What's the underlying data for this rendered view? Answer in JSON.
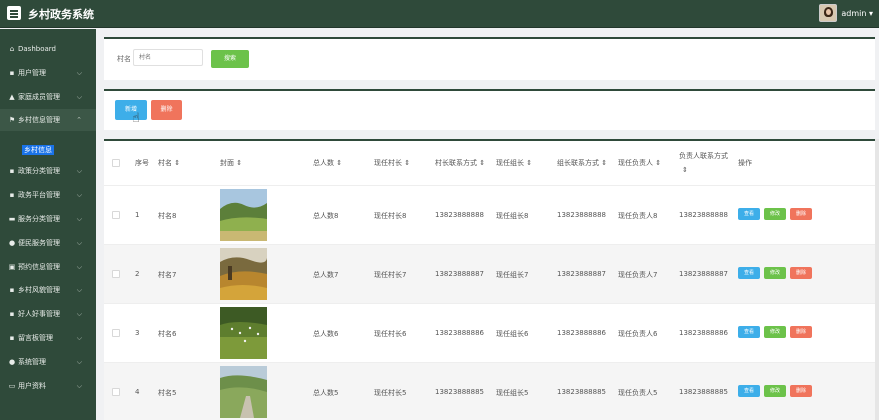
{
  "app": {
    "title": "乡村政务系统",
    "username": "admin ▾"
  },
  "sidebar": {
    "items": [
      {
        "label": "Dashboard",
        "icon": "⌂",
        "chevron": ""
      },
      {
        "label": "用户管理",
        "icon": "▪",
        "chevron": "⌵"
      },
      {
        "label": "家庭成员管理",
        "icon": "▲",
        "chevron": "⌵"
      },
      {
        "label": "乡村信息管理",
        "icon": "⚑",
        "chevron": "⌃"
      },
      {
        "label": "政策分类管理",
        "icon": "▪",
        "chevron": "⌵"
      },
      {
        "label": "政务平台管理",
        "icon": "▪",
        "chevron": "⌵"
      },
      {
        "label": "服务分类管理",
        "icon": "▬",
        "chevron": "⌵"
      },
      {
        "label": "便民服务管理",
        "icon": "●",
        "chevron": "⌵"
      },
      {
        "label": "预约信息管理",
        "icon": "▣",
        "chevron": "⌵"
      },
      {
        "label": "乡村风貌管理",
        "icon": "▪",
        "chevron": "⌵"
      },
      {
        "label": "好人好事管理",
        "icon": "▪",
        "chevron": "⌵"
      },
      {
        "label": "留言板管理",
        "icon": "▪",
        "chevron": "⌵"
      },
      {
        "label": "系统管理",
        "icon": "●",
        "chevron": "⌵"
      },
      {
        "label": "用户资料",
        "icon": "▭",
        "chevron": "⌵"
      }
    ],
    "sub_item": "乡村信息"
  },
  "search": {
    "label": "村名",
    "placeholder": "村名",
    "button": "搜索"
  },
  "actions": {
    "add": "新增",
    "delete": "删除"
  },
  "table": {
    "headers": [
      "序号",
      "村名 ⇕",
      "封面 ⇕",
      "总人数 ⇕",
      "现任村长 ⇕",
      "村长联系方式 ⇕",
      "现任组长 ⇕",
      "组长联系方式 ⇕",
      "现任负责人 ⇕",
      "负责人联系方式",
      "⇕",
      "操作"
    ],
    "rows": [
      {
        "index": "1",
        "name": "村名8",
        "population": "总人数8",
        "chief": "现任村长8",
        "chief_phone": "13823888888",
        "leader": "现任组长8",
        "leader_phone": "13823888888",
        "manager": "现任负责人8",
        "manager_phone": "13823888888"
      },
      {
        "index": "2",
        "name": "村名7",
        "population": "总人数7",
        "chief": "现任村长7",
        "chief_phone": "13823888887",
        "leader": "现任组长7",
        "leader_phone": "13823888887",
        "manager": "现任负责人7",
        "manager_phone": "13823888887"
      },
      {
        "index": "3",
        "name": "村名6",
        "population": "总人数6",
        "chief": "现任村长6",
        "chief_phone": "13823888886",
        "leader": "现任组长6",
        "leader_phone": "13823888886",
        "manager": "现任负责人6",
        "manager_phone": "13823888886"
      },
      {
        "index": "4",
        "name": "村名5",
        "population": "总人数5",
        "chief": "现任村长5",
        "chief_phone": "13823888885",
        "leader": "现任组长5",
        "leader_phone": "13823888885",
        "manager": "现任负责人5",
        "manager_phone": "13823888885"
      }
    ],
    "op_labels": {
      "view": "查看",
      "edit": "修改",
      "delete": "删除"
    }
  },
  "colors": {
    "sidebar": "#2f4a3a",
    "primary": "#3daee9",
    "success": "#6cc24a",
    "danger": "#f0745c"
  }
}
